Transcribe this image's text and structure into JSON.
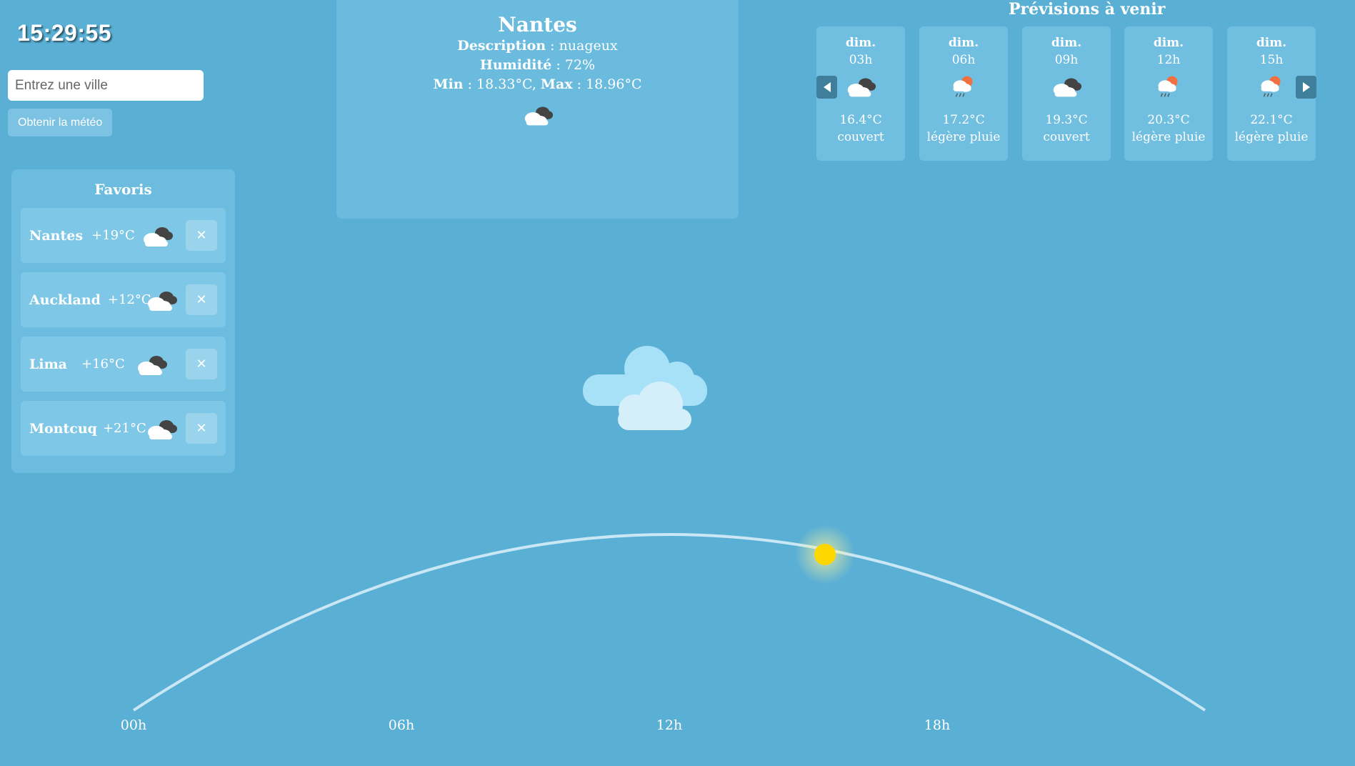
{
  "clock": "15:29:55",
  "search": {
    "placeholder": "Entrez une ville",
    "button_label": "Obtenir la météo"
  },
  "favorites": {
    "title": "Favoris",
    "items": [
      {
        "name": "Nantes",
        "temp": "+19°C",
        "icon": "cloudy-icon"
      },
      {
        "name": "Auckland",
        "temp": "+12°C",
        "icon": "cloudy-icon"
      },
      {
        "name": "Lima",
        "temp": "+16°C",
        "icon": "cloudy-icon"
      },
      {
        "name": "Montcuq",
        "temp": "+21°C",
        "icon": "cloudy-icon"
      }
    ],
    "remove_glyph": "✕"
  },
  "current": {
    "city": "Nantes",
    "description_label": "Description",
    "description": "nuageux",
    "humidity_label": "Humidité",
    "humidity": "72%",
    "min_label": "Min",
    "min": "18.33°C",
    "max_label": "Max",
    "max": "18.96°C",
    "icon": "cloudy-icon"
  },
  "forecast": {
    "title": "Prévisions à venir",
    "cards": [
      {
        "day": "dim.",
        "hour": "03h",
        "temp": "16.4°C",
        "desc": "couvert",
        "icon": "cloudy-icon"
      },
      {
        "day": "dim.",
        "hour": "06h",
        "temp": "17.2°C",
        "desc": "légère pluie",
        "icon": "sun-rain-icon"
      },
      {
        "day": "dim.",
        "hour": "09h",
        "temp": "19.3°C",
        "desc": "couvert",
        "icon": "cloudy-icon"
      },
      {
        "day": "dim.",
        "hour": "12h",
        "temp": "20.3°C",
        "desc": "légère pluie",
        "icon": "sun-rain-icon"
      },
      {
        "day": "dim.",
        "hour": "15h",
        "temp": "22.1°C",
        "desc": "légère pluie",
        "icon": "sun-rain-icon"
      }
    ]
  },
  "sun_path": {
    "hour_labels": [
      "00h",
      "06h",
      "12h",
      "18h"
    ],
    "current_time": "15:29"
  },
  "colors": {
    "background": "#5aafd5",
    "panel": "#6abbde",
    "sun": "#ffd700",
    "arc": "#c9e7f4"
  }
}
